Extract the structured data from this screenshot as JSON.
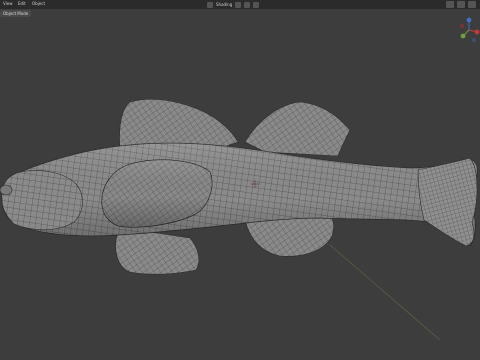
{
  "menubar": {
    "items": [
      "View",
      "Edit",
      "Object"
    ]
  },
  "viewport": {
    "mode_label": "Object Mode",
    "shading_label": "Shading",
    "background_color": "#3d3d3d",
    "mesh_color": "#8d8d8d",
    "wire_color": "#2e2e2e"
  },
  "icons": {
    "cursor": "3d-cursor-icon",
    "gizmo": "navigation-gizmo-icon",
    "view_buttons": [
      "viewport-shading-solid-icon",
      "viewport-shading-material-icon",
      "viewport-shading-rendered-icon"
    ]
  },
  "axis_colors": {
    "x": "#c23b3b",
    "y": "#6ea03f",
    "z": "#3d6fc2"
  }
}
